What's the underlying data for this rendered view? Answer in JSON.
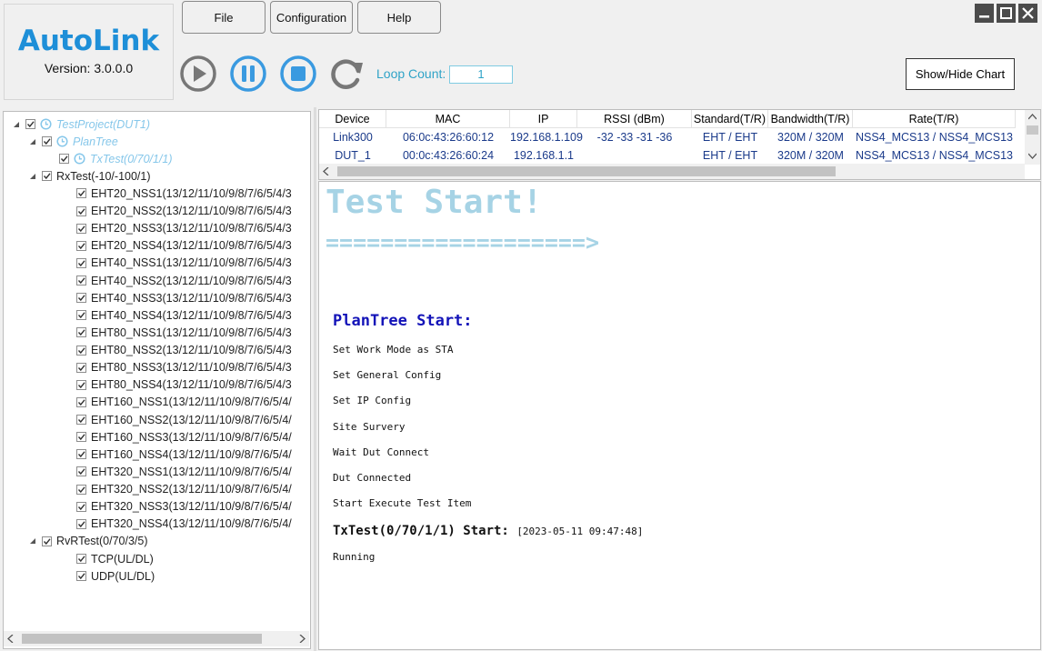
{
  "app": {
    "name": "AutoLink",
    "version": "Version: 3.0.0.0"
  },
  "menu": {
    "file": "File",
    "configuration": "Configuration",
    "help": "Help"
  },
  "toolbar": {
    "loop_label": "Loop Count:",
    "loop_value": "1",
    "chart_toggle": "Show/Hide Chart",
    "icons": [
      "play-icon",
      "pause-icon",
      "stop-icon",
      "refresh-icon"
    ]
  },
  "window": {
    "icons": [
      "minimize-icon",
      "maximize-icon",
      "close-icon"
    ]
  },
  "tree": [
    {
      "label": "TestProject(DUT1)",
      "depth": 0,
      "expand": "expanded",
      "clock": true,
      "style": "blue"
    },
    {
      "label": "PlanTree",
      "depth": 1,
      "expand": "expanded",
      "clock": true,
      "style": "blue"
    },
    {
      "label": "TxTest(0/70/1/1)",
      "depth": 2,
      "expand": "none",
      "clock": true,
      "style": "blue"
    },
    {
      "label": "RxTest(-10/-100/1)",
      "depth": 1,
      "expand": "expanded",
      "clock": false,
      "style": "dark"
    },
    {
      "label": "EHT20_NSS1(13/12/11/10/9/8/7/6/5/4/3",
      "depth": 3,
      "expand": "none",
      "clock": false,
      "style": "dark"
    },
    {
      "label": "EHT20_NSS2(13/12/11/10/9/8/7/6/5/4/3",
      "depth": 3,
      "expand": "none",
      "clock": false,
      "style": "dark"
    },
    {
      "label": "EHT20_NSS3(13/12/11/10/9/8/7/6/5/4/3",
      "depth": 3,
      "expand": "none",
      "clock": false,
      "style": "dark"
    },
    {
      "label": "EHT20_NSS4(13/12/11/10/9/8/7/6/5/4/3",
      "depth": 3,
      "expand": "none",
      "clock": false,
      "style": "dark"
    },
    {
      "label": "EHT40_NSS1(13/12/11/10/9/8/7/6/5/4/3",
      "depth": 3,
      "expand": "none",
      "clock": false,
      "style": "dark"
    },
    {
      "label": "EHT40_NSS2(13/12/11/10/9/8/7/6/5/4/3",
      "depth": 3,
      "expand": "none",
      "clock": false,
      "style": "dark"
    },
    {
      "label": "EHT40_NSS3(13/12/11/10/9/8/7/6/5/4/3",
      "depth": 3,
      "expand": "none",
      "clock": false,
      "style": "dark"
    },
    {
      "label": "EHT40_NSS4(13/12/11/10/9/8/7/6/5/4/3",
      "depth": 3,
      "expand": "none",
      "clock": false,
      "style": "dark"
    },
    {
      "label": "EHT80_NSS1(13/12/11/10/9/8/7/6/5/4/3",
      "depth": 3,
      "expand": "none",
      "clock": false,
      "style": "dark"
    },
    {
      "label": "EHT80_NSS2(13/12/11/10/9/8/7/6/5/4/3",
      "depth": 3,
      "expand": "none",
      "clock": false,
      "style": "dark"
    },
    {
      "label": "EHT80_NSS3(13/12/11/10/9/8/7/6/5/4/3",
      "depth": 3,
      "expand": "none",
      "clock": false,
      "style": "dark"
    },
    {
      "label": "EHT80_NSS4(13/12/11/10/9/8/7/6/5/4/3",
      "depth": 3,
      "expand": "none",
      "clock": false,
      "style": "dark"
    },
    {
      "label": "EHT160_NSS1(13/12/11/10/9/8/7/6/5/4/",
      "depth": 3,
      "expand": "none",
      "clock": false,
      "style": "dark"
    },
    {
      "label": "EHT160_NSS2(13/12/11/10/9/8/7/6/5/4/",
      "depth": 3,
      "expand": "none",
      "clock": false,
      "style": "dark"
    },
    {
      "label": "EHT160_NSS3(13/12/11/10/9/8/7/6/5/4/",
      "depth": 3,
      "expand": "none",
      "clock": false,
      "style": "dark"
    },
    {
      "label": "EHT160_NSS4(13/12/11/10/9/8/7/6/5/4/",
      "depth": 3,
      "expand": "none",
      "clock": false,
      "style": "dark"
    },
    {
      "label": "EHT320_NSS1(13/12/11/10/9/8/7/6/5/4/",
      "depth": 3,
      "expand": "none",
      "clock": false,
      "style": "dark"
    },
    {
      "label": "EHT320_NSS2(13/12/11/10/9/8/7/6/5/4/",
      "depth": 3,
      "expand": "none",
      "clock": false,
      "style": "dark"
    },
    {
      "label": "EHT320_NSS3(13/12/11/10/9/8/7/6/5/4/",
      "depth": 3,
      "expand": "none",
      "clock": false,
      "style": "dark"
    },
    {
      "label": "EHT320_NSS4(13/12/11/10/9/8/7/6/5/4/",
      "depth": 3,
      "expand": "none",
      "clock": false,
      "style": "dark"
    },
    {
      "label": "RvRTest(0/70/3/5)",
      "depth": 1,
      "expand": "expanded",
      "clock": false,
      "style": "dark"
    },
    {
      "label": "TCP(UL/DL)",
      "depth": 3,
      "expand": "none",
      "clock": false,
      "style": "dark"
    },
    {
      "label": "UDP(UL/DL)",
      "depth": 3,
      "expand": "none",
      "clock": false,
      "style": "dark"
    }
  ],
  "device_table": {
    "columns": [
      "Device",
      "MAC",
      "IP",
      "RSSI (dBm)",
      "Standard(T/R)",
      "Bandwidth(T/R)",
      "Rate(T/R)"
    ],
    "rows": [
      [
        "Link300",
        "06:0c:43:26:60:12",
        "192.168.1.109",
        "-32 -33 -31 -36",
        "EHT / EHT",
        "320M / 320M",
        "NSS4_MCS13 / NSS4_MCS13"
      ],
      [
        "DUT_1",
        "00:0c:43:26:60:24",
        "192.168.1.1",
        "",
        "EHT / EHT",
        "320M / 320M",
        "NSS4_MCS13 / NSS4_MCS13"
      ]
    ]
  },
  "log": {
    "title": "Test Start!",
    "arrow": "===================>",
    "plan_start": "PlanTree Start:",
    "lines_a": [
      "Set Work Mode as STA",
      "Set General Config",
      "Set IP Config",
      "Site Survery",
      "Wait Dut Connect",
      "Dut Connected",
      "Start Execute Test Item"
    ],
    "tx_start": "TxTest(0/70/1/1) Start:",
    "tx_time": "[2023-05-11 09:47:48]",
    "running": "Running"
  },
  "colors": {
    "accent": "#1e8fd8",
    "tree_blue": "#86c7ea",
    "log_title": "#a6d3e5",
    "log_head": "#1313b8",
    "table_text": "#1a3a8a"
  }
}
